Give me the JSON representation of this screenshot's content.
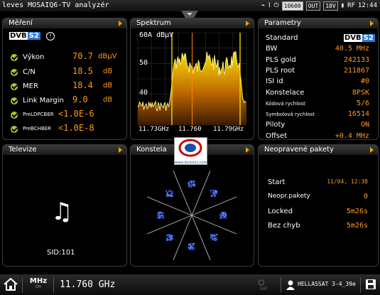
{
  "topbar": {
    "title": "leves MOSAIQ6-TV analyzér",
    "chip1": "10600",
    "chip2": "OUT",
    "chip3": "18V",
    "rf": "RF",
    "time": "12:44"
  },
  "mereni": {
    "title": "Měření",
    "dvb_d": "DVB",
    "dvb_s": "S2",
    "rows": [
      {
        "label": "Výkon",
        "value": "70.7",
        "unit": "dBµV"
      },
      {
        "label": "C/N",
        "value": "18.5",
        "unit": "dB"
      },
      {
        "label": "MER",
        "value": "18.4",
        "unit": "dB"
      },
      {
        "label": "Link Margin",
        "value": "9.0",
        "unit": "dB"
      },
      {
        "label": "PreLDPCBER",
        "value": "<1.0E-6",
        "unit": ""
      },
      {
        "label": "PreBCHBER",
        "value": "<1.0E-8",
        "unit": ""
      }
    ]
  },
  "spektrum": {
    "title": "Spektrum",
    "ref": "60A dBµV",
    "y50": "50",
    "y40": "40",
    "f_left": "11.73GHz",
    "f_mid": "11.760",
    "f_right": "11.79GHz"
  },
  "parametry": {
    "title": "Parametry",
    "rows": [
      {
        "label": "Standard",
        "value": ""
      },
      {
        "label": "BW",
        "value": "40.5 MHz"
      },
      {
        "label": "PLS gold",
        "value": "242133"
      },
      {
        "label": "PLS root",
        "value": "211867"
      },
      {
        "label": "ISI id",
        "value": "#0"
      },
      {
        "label": "Konstelace",
        "value": "8PSK"
      },
      {
        "label": "Kódová rychlost",
        "value": "5/6"
      },
      {
        "label": "Symbolová rychlost",
        "value": "16514"
      },
      {
        "label": "Piloty",
        "value": "ON"
      },
      {
        "label": "Offset",
        "value": "+0.4 MHz"
      }
    ],
    "dvb_d": "DVB",
    "dvb_s": "S2"
  },
  "televize": {
    "title": "Televize",
    "sid": "SID:101"
  },
  "konstelace": {
    "title": "Konstela",
    "logo_url": "www.dssistcs.com"
  },
  "pakety": {
    "title": "Neopravené pakety",
    "rows": [
      {
        "label": "Start",
        "value": "11/04, 12:38"
      },
      {
        "label": "Neopr.pakety",
        "value": "0"
      },
      {
        "label": "Locked",
        "value": "5m26s"
      },
      {
        "label": "Bez chyb",
        "value": "5m26s"
      }
    ]
  },
  "bottombar": {
    "mhz": "MHz",
    "ch": "CH",
    "freq": "11.760 GHz",
    "sat": "SAT",
    "satellite": "HELLASSAT 3-4_39e"
  },
  "colors": {
    "accent": "#ff9a1a",
    "check": "#a7c933",
    "spectrum": "#f2d400"
  }
}
